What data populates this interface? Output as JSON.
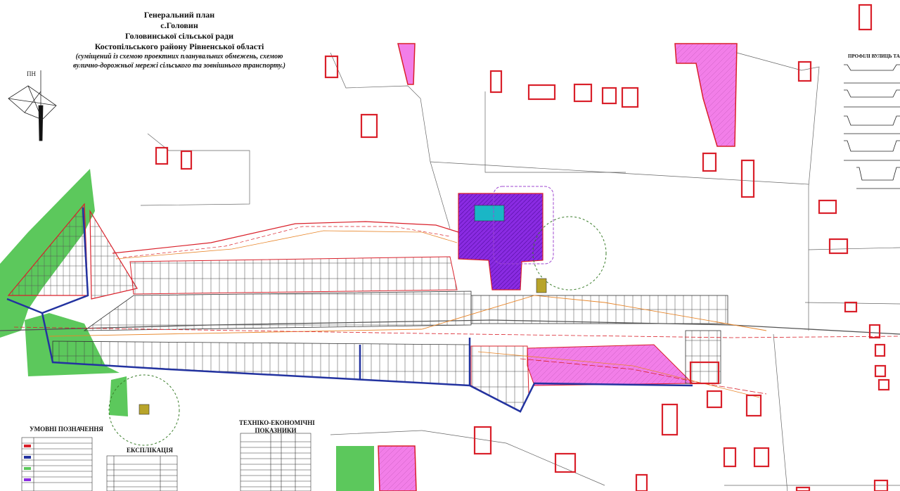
{
  "title": {
    "line1": "Генеральний план",
    "line2": "с.Головин",
    "line3": "Головинської сільської ради",
    "line4": "Костопільського району   Рівненської області",
    "note1": "(суміщений із схемою проектних планувальних обмежень, схемою",
    "note2": "вулично-дорожньої  мережі сільського та зовнішнього транспорту.)"
  },
  "north_label": "ПН",
  "legend_title": "УМОВНІ ПОЗНАЧЕННЯ",
  "explication_title": "ЕКСПЛІКАЦІЯ",
  "tech_title_1": "ТЕХНІКО-ЕКОНОМІЧНІ",
  "tech_title_2": "ПОКАЗНИКИ",
  "profiles_title": "ПРОФІЛІ ВУЛИЦЬ ТА ДОРІГ",
  "colors": {
    "green_zone": "#5cc85c",
    "pink_zone": "#f27ee8",
    "purple_zone": "#8a2be2",
    "red_boundary": "#d9202a",
    "road_blue": "#2333a0",
    "road_orange": "#e8862a",
    "gray_line": "#666666"
  }
}
